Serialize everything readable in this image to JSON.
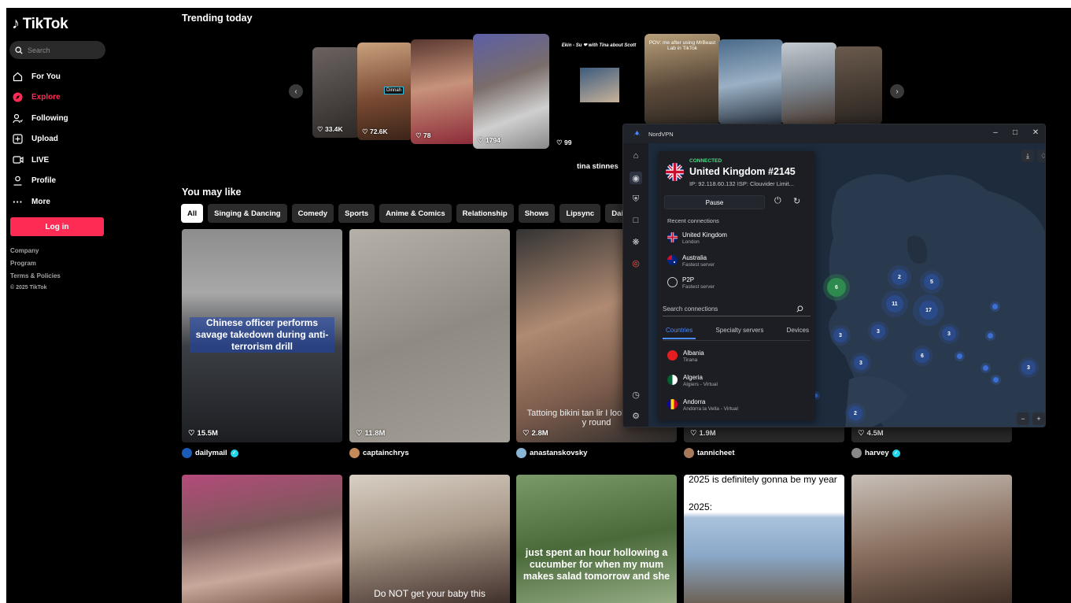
{
  "sidebar": {
    "logo": "TikTok",
    "search_placeholder": "Search",
    "nav": [
      {
        "label": "For You",
        "icon": "home-icon"
      },
      {
        "label": "Explore",
        "icon": "compass-icon"
      },
      {
        "label": "Following",
        "icon": "following-icon"
      },
      {
        "label": "Upload",
        "icon": "upload-icon"
      },
      {
        "label": "LIVE",
        "icon": "live-icon"
      },
      {
        "label": "Profile",
        "icon": "profile-icon"
      },
      {
        "label": "More",
        "icon": "more-icon"
      }
    ],
    "login": "Log in",
    "footer": [
      "Company",
      "Program",
      "Terms & Policies",
      "© 2025 TikTok"
    ]
  },
  "trending": {
    "title": "Trending today",
    "cards": [
      {
        "count": "33.4K",
        "caption": ""
      },
      {
        "count": "72.6K",
        "caption": "Dinnah"
      },
      {
        "count": "78",
        "caption": ""
      },
      {
        "count": "1794",
        "caption": ""
      },
      {
        "count": "99",
        "caption": "Ekin - Su ❤ with Tina about Scott"
      },
      {
        "count": "",
        "caption": "POV: me after using MrBeast Lab in TikTok"
      },
      {
        "count": "",
        "caption": ""
      },
      {
        "count": "",
        "caption": ""
      },
      {
        "count": "",
        "caption": ""
      }
    ],
    "featured_name": "tina stinnes"
  },
  "may_like": {
    "title": "You may like",
    "chips": [
      "All",
      "Singing & Dancing",
      "Comedy",
      "Sports",
      "Anime & Comics",
      "Relationship",
      "Shows",
      "Lipsync",
      "Daily L"
    ],
    "videos": [
      {
        "views": "15.5M",
        "author": "dailymail",
        "verified": true,
        "overlay": "Chinese officer performs savage takedown during anti-terrorism drill"
      },
      {
        "views": "11.8M",
        "author": "captainchrys",
        "verified": false,
        "overlay": ""
      },
      {
        "views": "2.8M",
        "author": "anastanskovsky",
        "verified": false,
        "overlay": "Tattoing bikini tan lir I look tanned all y round"
      },
      {
        "views": "1.9M",
        "author": "tannicheet",
        "verified": false,
        "overlay": ""
      },
      {
        "views": "4.5M",
        "author": "harvey",
        "verified": true,
        "overlay": ""
      }
    ],
    "row2": [
      {
        "overlay": ""
      },
      {
        "overlay": "Do NOT get your baby this"
      },
      {
        "overlay": "just spent an hour hollowing a cucumber for when my mum makes salad tomorrow and she"
      },
      {
        "overlay": "2025 is definitely gonna be my year",
        "overlay2": "2025:"
      },
      {
        "overlay": ""
      }
    ]
  },
  "nordvpn": {
    "window_title": "NordVPN",
    "status": "CONNECTED",
    "server": "United Kingdom #2145",
    "ip_line": "IP: 92.118.60.132   ISP: Clouvider Limit...",
    "pause": "Pause",
    "recent_title": "Recent connections",
    "recent": [
      {
        "name": "United Kingdom",
        "sub": "London"
      },
      {
        "name": "Australia",
        "sub": "Fastest server"
      },
      {
        "name": "P2P",
        "sub": "Fastest server"
      }
    ],
    "search_placeholder": "Search connections",
    "tabs": [
      "Countries",
      "Specialty servers",
      "Devices"
    ],
    "countries": [
      {
        "name": "Albania",
        "sub": "Tirana"
      },
      {
        "name": "Algeria",
        "sub": "Algiers - Virtual"
      },
      {
        "name": "Andorra",
        "sub": "Andorra la Vella - Virtual"
      }
    ],
    "map_clusters": [
      "6",
      "2",
      "5",
      "11",
      "17",
      "3",
      "3",
      "3",
      "6",
      "3",
      "3",
      "2"
    ],
    "zoom_out": "−",
    "zoom_in": "+"
  }
}
